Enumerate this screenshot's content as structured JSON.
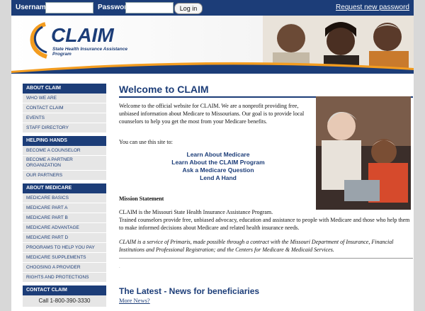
{
  "topbar": {
    "username_label": "Username:",
    "password_label": "Password:",
    "login_button": "Log in",
    "request_password": "Request new password"
  },
  "banner": {
    "logo_text": "CLAIM",
    "tagline": "State Health Insurance Assistance Program"
  },
  "sidebar": {
    "sections": [
      {
        "title": "ABOUT CLAIM",
        "items": [
          "WHO WE ARE",
          "CONTACT CLAIM",
          "EVENTS",
          "STAFF DIRECTORY"
        ]
      },
      {
        "title": "HELPING HANDS",
        "items": [
          "BECOME A COUNSELOR",
          "BECOME A PARTNER ORGANIZATION",
          "OUR PARTNERS"
        ]
      },
      {
        "title": "ABOUT MEDICARE",
        "items": [
          "MEDICARE BASICS",
          "MEDICARE PART A",
          "MEDICARE PART B",
          "MEDICARE ADVANTAGE",
          "MEDICARE PART D",
          "PROGRAMS TO HELP YOU PAY",
          "MEDICARE SUPPLEMENTS",
          "CHOOSING A PROVIDER",
          "RIGHTS AND PROTECTIONS"
        ]
      },
      {
        "title": "CONTACT CLAIM",
        "items": []
      }
    ],
    "phone": "Call 1-800-390-3330"
  },
  "main": {
    "title": "Welcome to CLAIM",
    "intro": "Welcome to the official website for CLAIM. We are a nonprofit providing free, unbiased information about Medicare to Missourians. Our goal is to provide local counselors to help you get the most from your Medicare benefits.",
    "use_site": "You can use this site to:",
    "links": [
      "Learn About Medicare",
      "Learn About the CLAIM Program",
      "Ask a Medicare Question",
      "Lend A Hand"
    ],
    "mission_heading": "Mission Statement",
    "mission_1": "CLAIM is the Missouri State Health Insurance Assistance Program.",
    "mission_2": "Trained counselors provide free, unbiased advocacy, education and assistance to people with Medicare and those who help them to make informed decisions about Medicare and related health insurance needs.",
    "primaris": "CLAIM is a service of Primaris, made possible through a contract with the Missouri Department of Insurance, Financial Institutions and Professional Registration; and the Centers for Medicare & Medicaid Services.",
    "latest": "The Latest - News for beneficiaries",
    "more_news": "More News?"
  }
}
